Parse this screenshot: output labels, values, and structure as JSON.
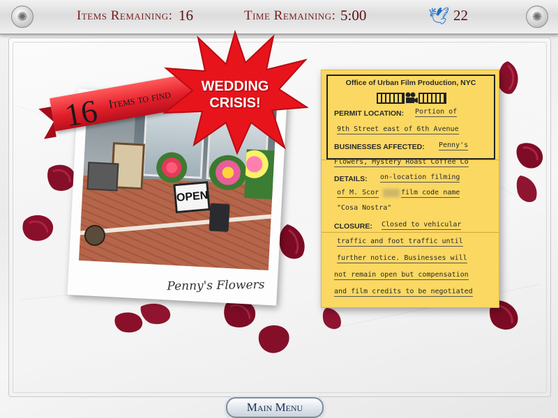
{
  "hud": {
    "items_label": "Items Remaining:",
    "items_value": "16",
    "time_label": "Time Remaining:",
    "time_value": "5:00",
    "bird_icon": "blue-bird-icon",
    "hint_count": "22"
  },
  "scene": {
    "ribbon_number": "16",
    "ribbon_text": "Items to find",
    "photo_caption": "Penny's Flowers",
    "shop_sign": "OPEN",
    "burst_line1": "WEDDING",
    "burst_line2": "CRISIS!"
  },
  "permit": {
    "title": "Office of Urban Film Production, NYC",
    "location_label": "PERMIT LOCATION:",
    "location_line1": "Portion of",
    "location_line2": "9th Street east of 6th Avenue",
    "businesses_label": "BUSINESSES AFFECTED:",
    "businesses_line1": "Penny's",
    "businesses_line2": "Flowers, Mystery Roast Coffee Co",
    "details_label": "DETAILS:",
    "details_line1": "on-location filming",
    "details_line2": "of M. Scor",
    "details_line2b": "film code name",
    "details_line3": "\"Cosa Nostra\"",
    "closure_label": "CLOSURE:",
    "closure_line1": "Closed to vehicular",
    "closure_line2": "traffic and foot traffic until",
    "closure_line3": "further notice. Businesses will",
    "closure_line4": "not remain open but compensation",
    "closure_line5": "and film credits to be negotiated"
  },
  "footer": {
    "main_menu": "Main Menu"
  },
  "colors": {
    "ribbon": "#e3202b",
    "burst": "#e8141c",
    "note": "#fbd862",
    "petal": "#8a0f2a"
  }
}
